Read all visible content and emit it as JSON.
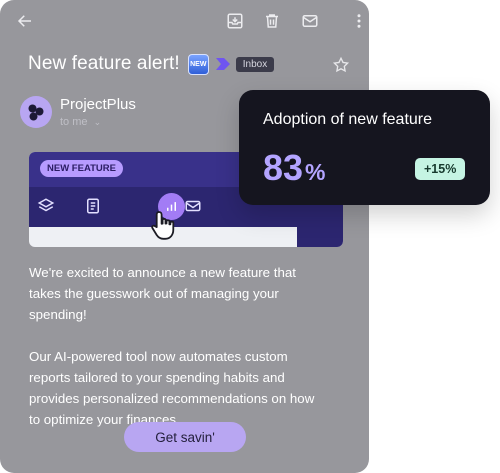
{
  "email": {
    "subject": "New feature alert!",
    "new_badge": "NEW",
    "folder_label": "Inbox",
    "sender": {
      "name": "ProjectPlus",
      "recipient": "to me"
    },
    "banner": {
      "pill_label": "NEW FEATURE"
    },
    "body_paragraphs": [
      "We're excited to announce a new feature that takes the guesswork out of managing your spending!",
      "Our AI-powered tool now automates custom reports tailored to your spending habits and provides personalized recommendations on how to optimize your finances."
    ],
    "cta_label": "Get savin'"
  },
  "stat": {
    "title": "Adoption of new feature",
    "value": "83",
    "unit": "%",
    "delta": "+15%"
  },
  "colors": {
    "card_bg": "#97979c",
    "accent": "#b8a6f2",
    "stat_bg": "#15151f",
    "stat_value": "#b3a4ff",
    "delta_bg": "#c5f4e3"
  }
}
